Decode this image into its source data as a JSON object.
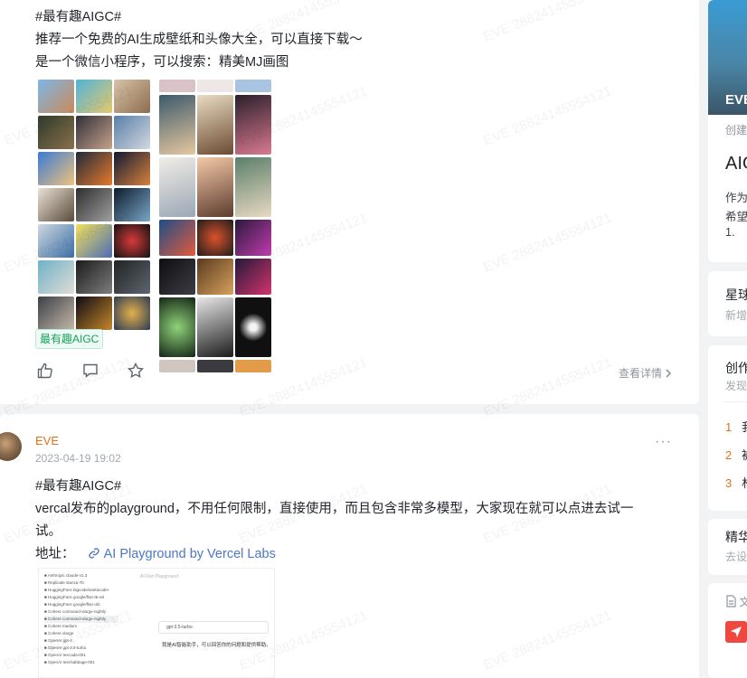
{
  "post1": {
    "hashtag_line": "#最有趣AIGC#",
    "line1": "推荐一个免费的AI生成壁纸和头像大全，可以直接下载～",
    "line2": "是一个微信小程序，可以搜索：精美MJ画图",
    "tag": "最有趣AIGC",
    "details_label": "查看详情"
  },
  "post2": {
    "author": "EVE",
    "date": "2023-04-19 19:02",
    "hashtag_line": "#最有趣AIGC#",
    "body_line1": "vercal发布的playground，不用任何限制，直接使用，而且包含非常多模型，大家现在就可以点进去试一",
    "body_line2": "试。",
    "address_label": "地址：",
    "link_text": "AI Playground by Vercel Labs",
    "shot_input_placeholder": "gpt-3.5-turbo",
    "shot_text": "我是AI智能助手，可以回答你的问题和提供帮助。",
    "shot_header": "AI Run Playground",
    "shot_models": [
      "Anthropic claude-v1.3",
      "Replicate stanza-7b",
      "HuggingFace bigcode/santacoder",
      "HuggingFace google/flan-t5-xxl",
      "HuggingFace google/flan-ul2",
      "Cohere command-xlarge-nightly",
      "Cohere command-xlarge-nightly",
      "Cohere medium",
      "Cohere xlarge",
      "OpenAI gpt-4",
      "OpenAI gpt-3.5-turbo",
      "OpenAI text-ada-001",
      "OpenAI text-babbage-001"
    ]
  },
  "sidebar": {
    "banner_label": "EVE",
    "created_label": "创建",
    "title": "AIG",
    "desc1": "作为",
    "desc2": "希望",
    "desc3": "1.",
    "section2_title": "星球",
    "section2_sub": "新增",
    "section3_title": "创作",
    "section3_sub": "发现",
    "rank": [
      "1",
      "2",
      "3"
    ],
    "rank_text": [
      "我",
      "被",
      "林"
    ],
    "section4_title": "精华",
    "section4_sub": "去设",
    "doc_label": "文"
  },
  "watermark_text": "EVE 28824145554121",
  "colors": {
    "accent": "#e37318",
    "tag": "#18a058",
    "link": "#4a78c6"
  }
}
